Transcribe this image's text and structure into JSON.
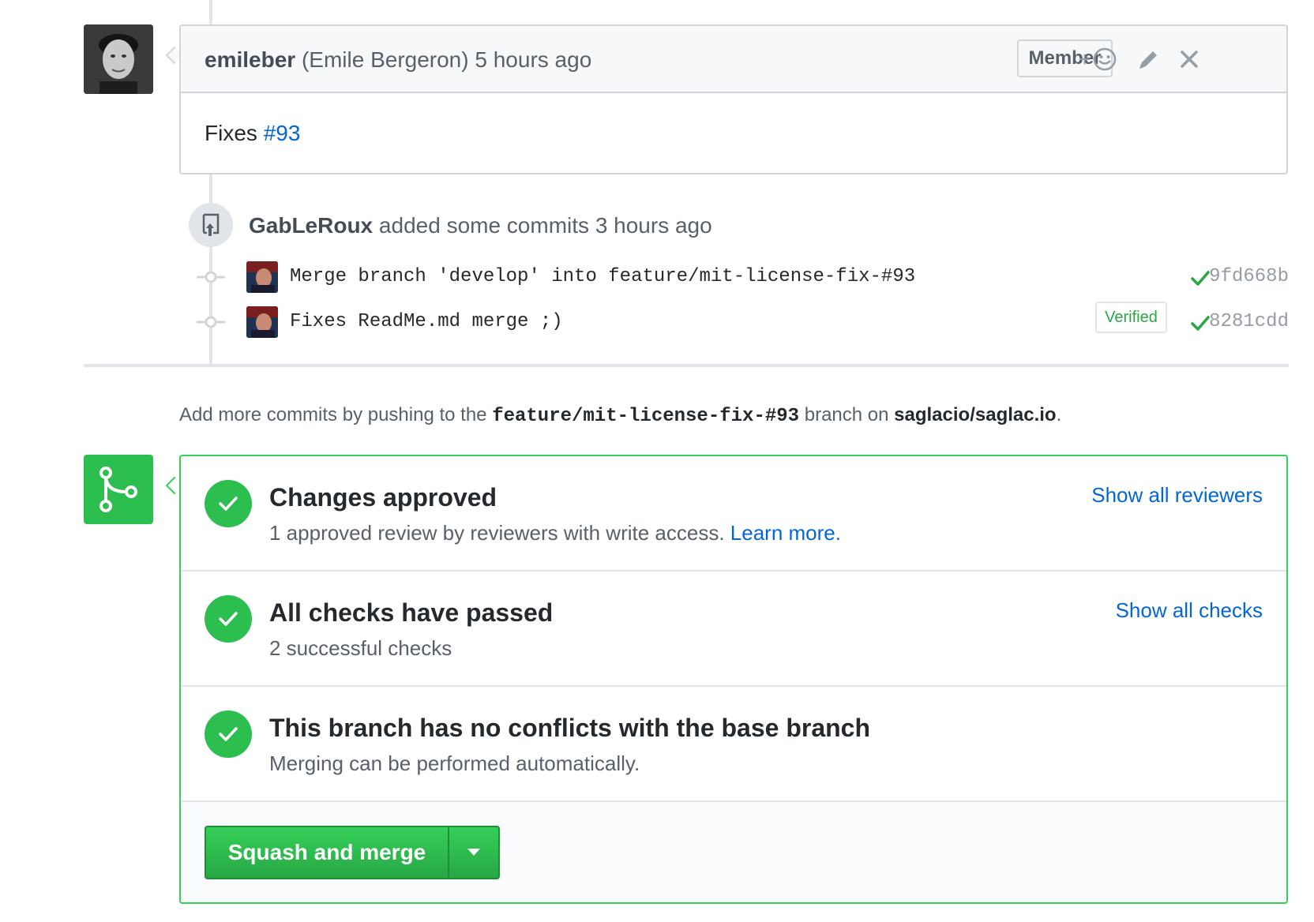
{
  "comment": {
    "author": "emileber",
    "full_name": "(Emile Bergeron)",
    "time": "5 hours ago",
    "badge": "Member",
    "add_reaction": "+",
    "body_prefix": "Fixes ",
    "issue_link": "#93"
  },
  "commits_event": {
    "author": "GabLeRoux",
    "action": "added some commits",
    "time": "3 hours ago",
    "commits": [
      {
        "message": "Merge branch 'develop' into feature/mit-license-fix-#93",
        "sha": "9fd668b",
        "verified": ""
      },
      {
        "message": "Fixes ReadMe.md merge ;)",
        "sha": "8281cdd",
        "verified": "Verified"
      }
    ]
  },
  "push_note": {
    "prefix": "Add more commits by pushing to the ",
    "branch": "feature/mit-license-fix-#93",
    "middle": " branch on ",
    "repo": "saglacio/saglac.io",
    "suffix": "."
  },
  "merge_box": {
    "sections": [
      {
        "title": "Changes approved",
        "desc": "1 approved review by reviewers with write access. ",
        "desc_link": "Learn more.",
        "link": "Show all reviewers"
      },
      {
        "title": "All checks have passed",
        "desc": "2 successful checks",
        "link": "Show all checks"
      },
      {
        "title": "This branch has no conflicts with the base branch",
        "desc": "Merging can be performed automatically."
      }
    ],
    "merge_button": "Squash and merge"
  },
  "colors": {
    "success": "#2cbe4e",
    "link": "#0366d6",
    "border": "#d1d5da"
  },
  "icons": [
    "smiley-icon",
    "pencil-icon",
    "close-icon",
    "repo-push-icon",
    "git-commit-icon",
    "check-icon",
    "git-merge-icon",
    "triangle-down-icon"
  ]
}
